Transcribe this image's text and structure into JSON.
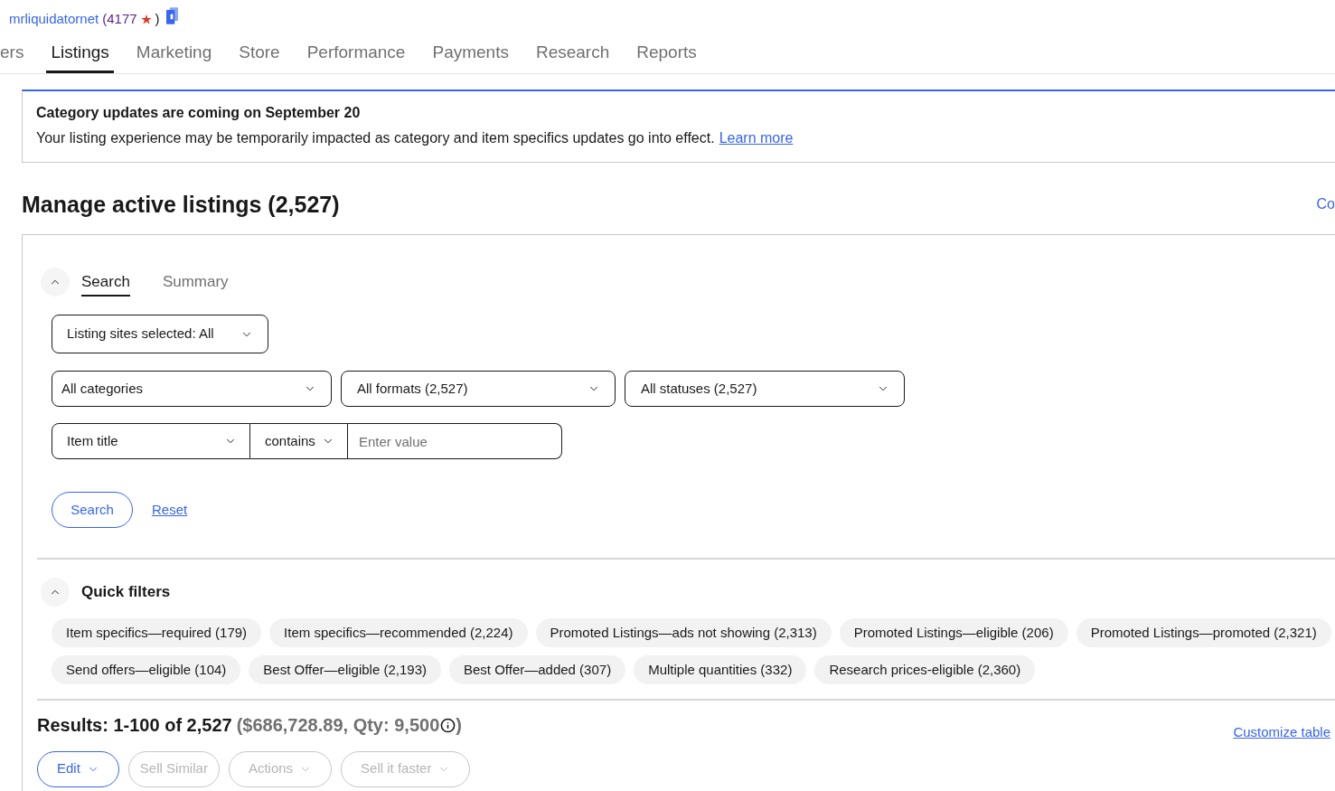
{
  "seller": {
    "name": "mrliquidatornet",
    "feedback_score": "(4177",
    "feedback_close": ")"
  },
  "nav_tabs": [
    {
      "label": "ers",
      "selected": false
    },
    {
      "label": "Listings",
      "selected": true
    },
    {
      "label": "Marketing",
      "selected": false
    },
    {
      "label": "Store",
      "selected": false
    },
    {
      "label": "Performance",
      "selected": false
    },
    {
      "label": "Payments",
      "selected": false
    },
    {
      "label": "Research",
      "selected": false
    },
    {
      "label": "Reports",
      "selected": false
    }
  ],
  "notice": {
    "title": "Category updates are coming on September 20",
    "message": "Your listing experience may be temporarily impacted as category and item specifics updates go into effect.",
    "link": "Learn more"
  },
  "page": {
    "title": "Manage active listings (2,527)",
    "link": "Co"
  },
  "search_panel": {
    "expanded": true,
    "tabs": [
      {
        "label": "Search",
        "selected": true
      },
      {
        "label": "Summary",
        "selected": false
      }
    ],
    "site_select": {
      "value": "Listing sites selected: All"
    },
    "filters": [
      {
        "value": "All categories"
      },
      {
        "value": "All formats (2,527)"
      },
      {
        "value": "All statuses (2,527)"
      }
    ],
    "field_select": {
      "value": "Item title"
    },
    "operator_select": {
      "value": "contains"
    },
    "value_input": {
      "placeholder": "Enter value"
    },
    "search_button": "Search",
    "reset_link": "Reset"
  },
  "quick_filters": {
    "title": "Quick filters",
    "expanded": true,
    "chips": [
      "Item specifics—required (179)",
      "Item specifics—recommended (2,224)",
      "Promoted Listings—ads not showing (2,313)",
      "Promoted Listings—eligible (206)",
      "Promoted Listings—promoted (2,321)",
      "Send offers—eligible (104)",
      "Best Offer—eligible (2,193)",
      "Best Offer—added (307)",
      "Multiple quantities (332)",
      "Research prices-eligible (2,360)"
    ]
  },
  "results": {
    "title": "Results: 1-100 of 2,527",
    "totals": "($686,728.89, Qty: 9,500",
    "totals_close": ")",
    "customize_link": "Customize table",
    "actions": [
      {
        "label": "Edit",
        "disabled": false,
        "dropdown": true
      },
      {
        "label": "Sell Similar",
        "disabled": true,
        "dropdown": false
      },
      {
        "label": "Actions",
        "disabled": true,
        "dropdown": true
      },
      {
        "label": "Sell it faster",
        "disabled": true,
        "dropdown": true
      }
    ]
  }
}
